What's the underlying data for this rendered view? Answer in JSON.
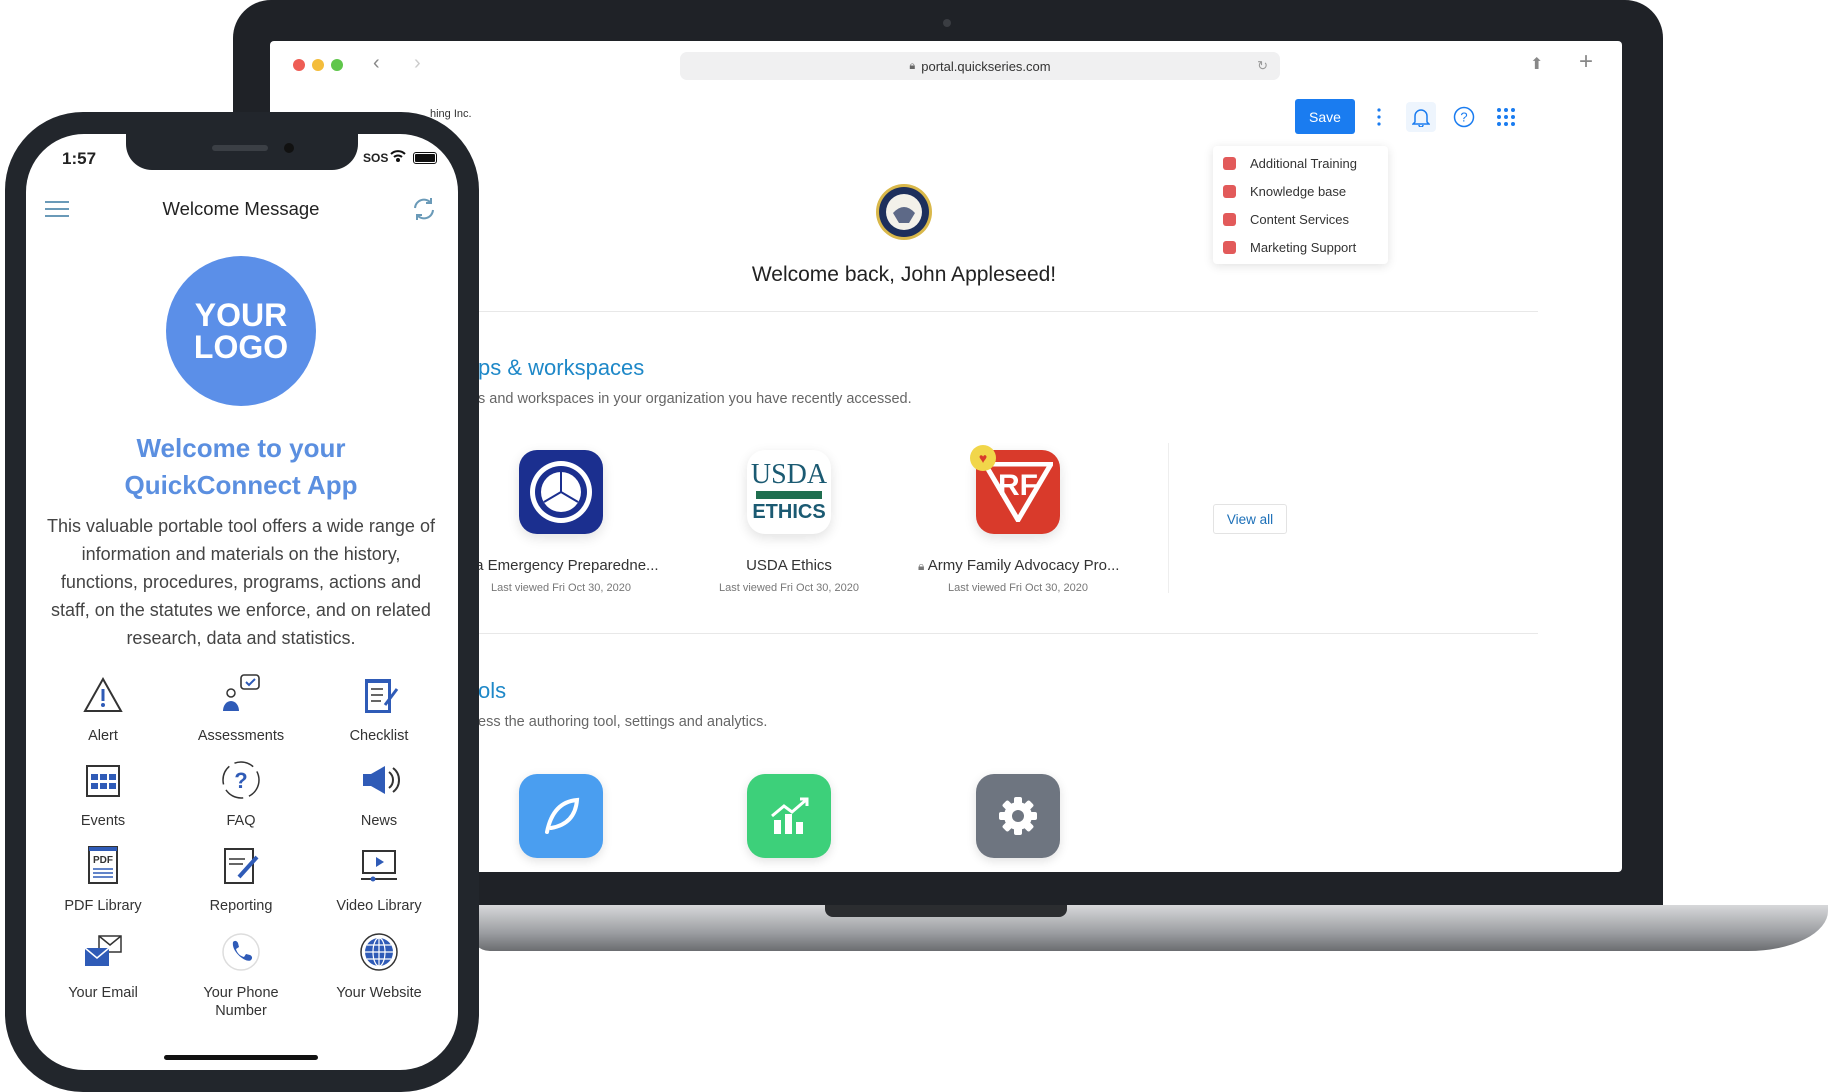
{
  "browser": {
    "url": "portal.quickseries.com"
  },
  "portal": {
    "org_name_partial": "hing Inc.",
    "save_label": "Save",
    "menu_items": [
      {
        "label": "Additional Training"
      },
      {
        "label": "Knowledge base"
      },
      {
        "label": "Content Services"
      },
      {
        "label": "Marketing Support"
      }
    ],
    "welcome": "Welcome back, John Appleseed!",
    "apps_section": {
      "title": "ps & workspaces",
      "subtitle": "s and workspaces in your organization you have recently accessed.",
      "apps": [
        {
          "name": "ida Emergency Preparedne...",
          "date": "Last viewed Fri Oct 30, 2020"
        },
        {
          "name": "USDA Ethics",
          "date": "Last viewed Fri Oct 30, 2020",
          "logo_top": "USDA",
          "logo_bottom": "ETHICS"
        },
        {
          "name": "Army Family Advocacy Pro...",
          "date": "Last viewed Fri Oct 30, 2020",
          "logo": "RF"
        }
      ],
      "view_all": "View all"
    },
    "tools_section": {
      "title": "ols",
      "subtitle": "ess the authoring tool, settings and analytics.",
      "colors": {
        "author": "#4a9ef0",
        "analytics": "#3dd07a",
        "settings": "#6e7580"
      }
    }
  },
  "phone": {
    "time": "1:57",
    "status": "SOS",
    "header_title": "Welcome Message",
    "logo_line1": "YOUR",
    "logo_line2": "LOGO",
    "title_line1": "Welcome to your",
    "title_line2": "QuickConnect App",
    "body": "This valuable portable tool offers a wide range of information and materials on the history, functions, procedures, programs, actions and staff, on the statutes we enforce, and on related research, data and statistics.",
    "grid": [
      {
        "label": "Alert",
        "icon": "alert-icon"
      },
      {
        "label": "Assessments",
        "icon": "assessments-icon"
      },
      {
        "label": "Checklist",
        "icon": "checklist-icon"
      },
      {
        "label": "Events",
        "icon": "calendar-icon"
      },
      {
        "label": "FAQ",
        "icon": "question-icon"
      },
      {
        "label": "News",
        "icon": "megaphone-icon"
      },
      {
        "label": "PDF Library",
        "icon": "pdf-icon"
      },
      {
        "label": "Reporting",
        "icon": "report-icon"
      },
      {
        "label": "Video Library",
        "icon": "video-icon"
      },
      {
        "label": "Your Email",
        "icon": "email-icon"
      },
      {
        "label": "Your Phone Number",
        "icon": "phone-icon"
      },
      {
        "label": "Your Website",
        "icon": "globe-icon"
      }
    ],
    "accent": "#5b8fe8"
  }
}
